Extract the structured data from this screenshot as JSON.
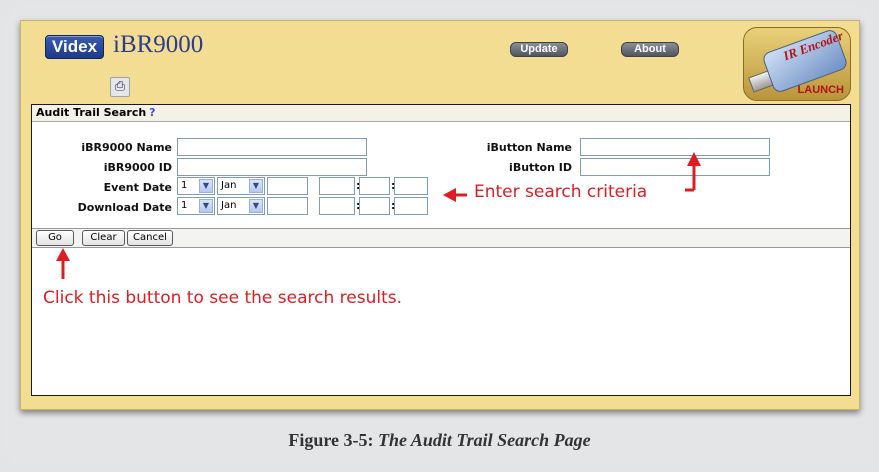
{
  "header": {
    "logo_text": "Videx",
    "product_name": "iBR9000",
    "update_label": "Update",
    "about_label": "About",
    "launcher_brand": "IR Encoder",
    "launcher_label": "LAUNCH"
  },
  "panel": {
    "title": "Audit Trail Search",
    "help": "?"
  },
  "form": {
    "ibr_name_label": "iBR9000 Name",
    "ibr_id_label": "iBR9000 ID",
    "event_date_label": "Event Date",
    "download_date_label": "Download Date",
    "ibutton_name_label": "iButton Name",
    "ibutton_id_label": "iButton ID",
    "event_day": "1",
    "event_month": "Jan",
    "download_day": "1",
    "download_month": "Jan"
  },
  "buttons": {
    "go": "Go",
    "clear": "Clear",
    "cancel": "Cancel"
  },
  "annotations": {
    "search_hint": "Enter search criteria",
    "go_hint": "Click this button to see the search results."
  },
  "figure": {
    "number": "Figure 3-5:",
    "title": "The Audit Trail Search Page"
  },
  "colors": {
    "app_background": "#f2dd92",
    "annotation": "#e11b22"
  }
}
